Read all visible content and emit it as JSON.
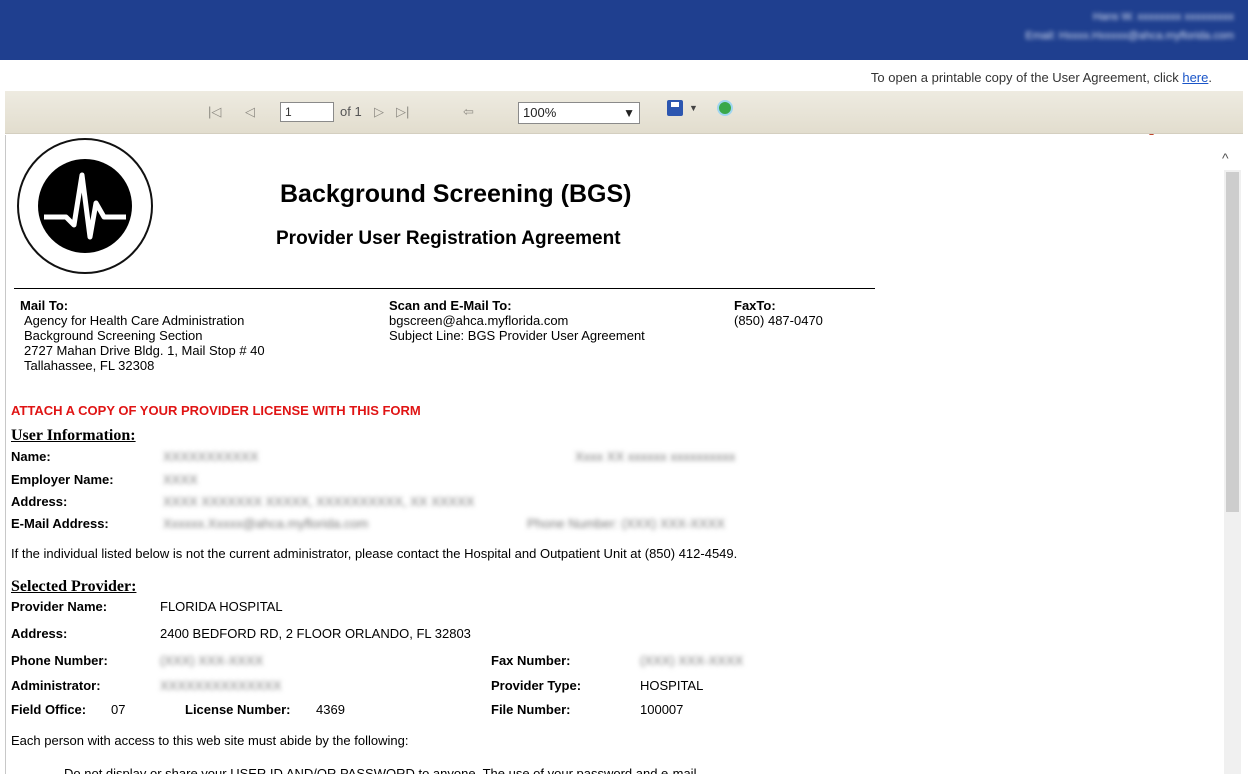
{
  "header": {
    "user_line1": "Hans W. xxxxxxxx xxxxxxxxx",
    "user_line2": "Email: Hxxxx.Hxxxxx@ahca.myflorida.com"
  },
  "print_notice": {
    "text": "To open a printable copy of the User Agreement, click ",
    "link": "here",
    "suffix": "."
  },
  "toolbar": {
    "first_icon": "first-page-icon",
    "prev_icon": "previous-page-icon",
    "page_value": "1",
    "of_label": "of 1",
    "next_icon": "next-page-icon",
    "last_icon": "last-page-icon",
    "back_icon": "back-icon",
    "zoom_value": "100%",
    "save_icon": "save-icon",
    "refresh_icon": "refresh-icon"
  },
  "doc": {
    "title": "Background Screening (BGS)",
    "subtitle": "Provider User Registration Agreement",
    "mail_to": {
      "label": "Mail To:",
      "lines": [
        "Agency for Health Care Administration",
        "Background Screening Section",
        "2727 Mahan Drive Bldg. 1, Mail Stop # 40",
        "Tallahassee, FL 32308"
      ]
    },
    "scan_to": {
      "label": "Scan and E-Mail To:",
      "lines": [
        "bgscreen@ahca.myflorida.com",
        "Subject Line: BGS Provider User Agreement"
      ]
    },
    "fax_to": {
      "label": "FaxTo:",
      "lines": [
        "(850) 487-0470"
      ]
    },
    "attach_notice": "ATTACH A COPY OF YOUR PROVIDER LICENSE WITH THIS FORM",
    "user_info": {
      "heading": "User Information:",
      "name_label": "Name:",
      "name_value": "XXXXXXXXXXX",
      "title_value": "Xxxx XX xxxxxx xxxxxxxxxx",
      "employer_label": "Employer Name:",
      "employer_value": "XXXX",
      "address_label": "Address:",
      "address_value": "XXXX XXXXXXX XXXXX, XXXXXXXXXX, XX XXXXX",
      "email_label": "E-Mail Address:",
      "email_value": "Xxxxxx.Xxxxx@ahca.myflorida.com",
      "phone_value": "Phone Number: (XXX) XXX-XXXX"
    },
    "admin_notice": "If the individual listed below is not the current administrator, please contact the Hospital and Outpatient Unit at (850) 412-4549.",
    "provider": {
      "heading": "Selected Provider:",
      "name_label": "Provider Name:",
      "name_value": "FLORIDA HOSPITAL",
      "address_label": "Address:",
      "address_value": "2400 BEDFORD RD, 2 FLOOR ORLANDO, FL 32803",
      "phone_label": "Phone Number:",
      "phone_value": "(XXX) XXX-XXXX",
      "fax_label": "Fax Number:",
      "fax_value": "(XXX) XXX-XXXX",
      "admin_label": "Administrator:",
      "admin_value": "XXXXXXXXXXXXXX",
      "type_label": "Provider Type:",
      "type_value": "HOSPITAL",
      "field_office_label": "Field Office:",
      "field_office_value": "07",
      "license_label": "License Number:",
      "license_value": "4369",
      "file_label": "File Number:",
      "file_value": "100007"
    },
    "rules_intro": "Each person with access to this web site must abide by the following:",
    "rule_1": "Do not display or share your USER ID AND/OR PASSWORD to anyone. The use of your password and e-mail"
  }
}
